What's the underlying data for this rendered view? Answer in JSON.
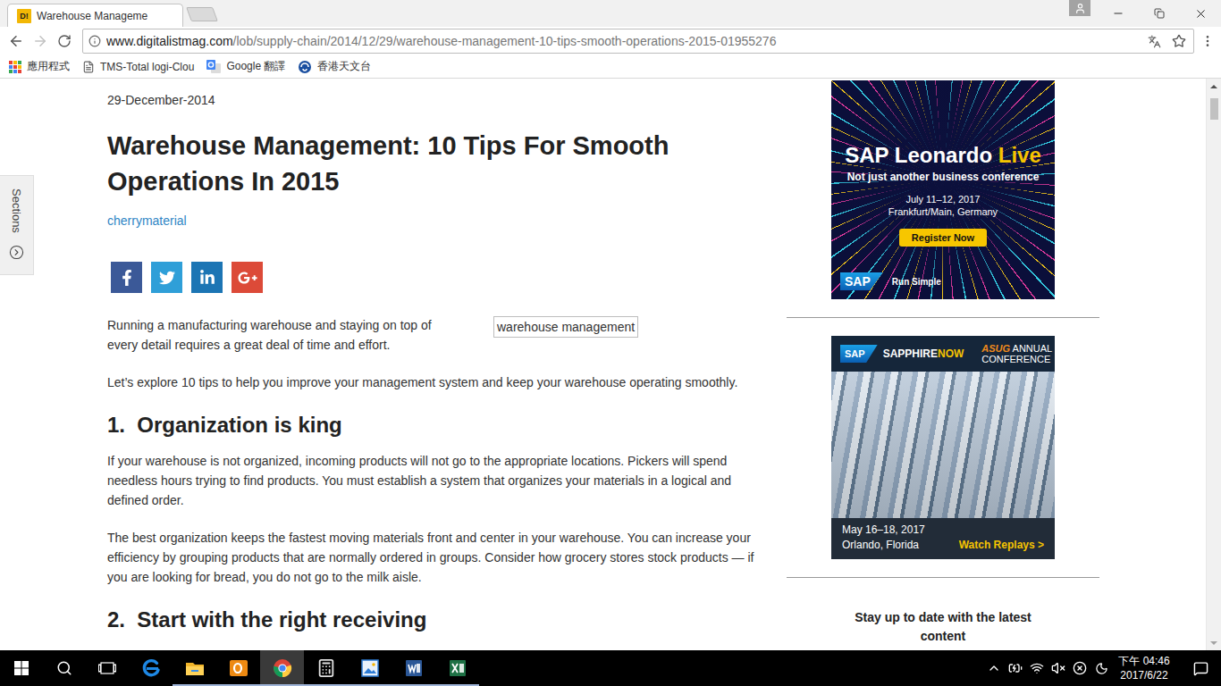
{
  "window": {
    "tabs": [
      {
        "title": "Warehouse Manageme",
        "icon_text": "D!",
        "selected": true
      }
    ]
  },
  "toolbar": {
    "back_disabled": false,
    "forward_disabled": true,
    "url_host": "www.digitalistmag.com",
    "url_path": "/lob/supply-chain/2014/12/29/warehouse-management-10-tips-smooth-operations-2015-01955276",
    "bookmarked": false
  },
  "bookmarks": [
    {
      "label": "應用程式",
      "kind": "apps"
    },
    {
      "label": "TMS-Total logi-Clou",
      "kind": "page"
    },
    {
      "label": "Google 翻譯",
      "kind": "translate"
    },
    {
      "label": "香港天文台",
      "kind": "hko"
    }
  ],
  "sections_tab": {
    "label": "Sections"
  },
  "article": {
    "date": "29-December-2014",
    "title": "Warehouse Management: 10 Tips For Smooth Operations In 2015",
    "author": "cherrymaterial",
    "share": [
      {
        "kind": "facebook",
        "color": "#3b5998"
      },
      {
        "kind": "twitter",
        "color": "#2f9fd8"
      },
      {
        "kind": "linkedin",
        "color": "#1c75b4"
      },
      {
        "kind": "googleplus",
        "color": "#dc4a38"
      }
    ],
    "intro": {
      "text": "Running a manufacturing warehouse and staying on top of every detail requires a great deal of time and effort.",
      "image_alt": "warehouse management"
    },
    "paragraphs": [
      "Let’s explore 10 tips to help you improve your management system and keep your warehouse operating smoothly."
    ],
    "sections": [
      {
        "heading": "1.  Organization is king",
        "paragraphs": [
          "If your warehouse is not organized, incoming products will not go to the appropriate locations. Pickers will spend needless hours trying to find products. You must establish a system that organizes your materials in a logical and defined order.",
          "The best organization keeps the fastest moving materials front and center in your warehouse. You can increase your efficiency by grouping products that are normally ordered in groups. Consider how grocery stores stock products — if you are looking for bread, you do not go to the milk aisle."
        ]
      },
      {
        "heading": "2.  Start with the right receiving",
        "paragraphs": []
      }
    ]
  },
  "sidebar": {
    "ads": [
      {
        "kind": "leonardo",
        "title": "SAP Leonardo",
        "title_accent": "Live",
        "subtitle": "Not just another business conference",
        "dates": "July 11–12, 2017",
        "place": "Frankfurt/Main, Germany",
        "button": "Register Now",
        "logo": "SAP",
        "tagline": "Run Simple"
      },
      {
        "kind": "sapphire",
        "logo": "SAP",
        "brand": "SAPPHIRE",
        "brand_accent": "NOW",
        "partner": "ASUG",
        "partner_line1": "ANNUAL",
        "partner_line2": "CONFERENCE",
        "dates": "May 16–18, 2017",
        "place": "Orlando, Florida",
        "button": "Watch Replays >"
      }
    ],
    "subscribe": "Stay up to date with the latest content"
  },
  "taskbar": {
    "apps": [
      {
        "kind": "edge",
        "running": false,
        "selected": false
      },
      {
        "kind": "explorer",
        "running": true,
        "selected": false
      },
      {
        "kind": "outlook",
        "running": true,
        "selected": false
      },
      {
        "kind": "chrome",
        "running": true,
        "selected": true
      },
      {
        "kind": "calculator",
        "running": true,
        "selected": false
      },
      {
        "kind": "photo",
        "running": true,
        "selected": false
      },
      {
        "kind": "word",
        "running": true,
        "selected": false
      },
      {
        "kind": "excel",
        "running": true,
        "selected": false
      }
    ],
    "time": "下午 04:46",
    "date": "2017/6/22"
  }
}
